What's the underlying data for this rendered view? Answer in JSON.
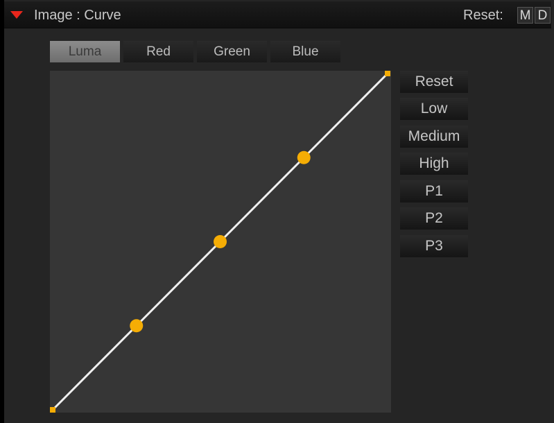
{
  "header": {
    "title": "Image : Curve",
    "reset_label": "Reset:",
    "m_label": "M",
    "d_label": "D"
  },
  "tabs": [
    {
      "label": "Luma",
      "active": true
    },
    {
      "label": "Red",
      "active": false
    },
    {
      "label": "Green",
      "active": false
    },
    {
      "label": "Blue",
      "active": false
    }
  ],
  "presets": [
    "Reset",
    "Low",
    "Medium",
    "High",
    "P1",
    "P2",
    "P3"
  ],
  "curve": {
    "line_color": "#f0f0f0",
    "point_color": "#f5ad05",
    "endpoints": [
      [
        0,
        0
      ],
      [
        1,
        1
      ]
    ],
    "control_points": [
      [
        0.25,
        0.25
      ],
      [
        0.5,
        0.5
      ],
      [
        0.75,
        0.75
      ]
    ]
  },
  "colors": {
    "collapse_icon": "#e8261c",
    "panel_bg": "#252525",
    "curve_bg": "#363636"
  }
}
